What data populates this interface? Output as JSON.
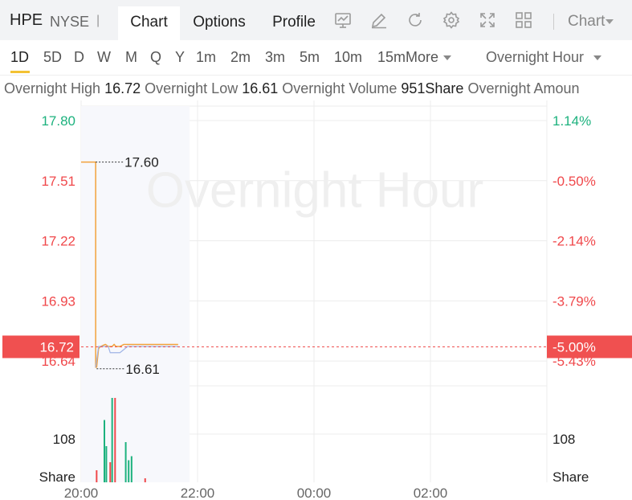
{
  "header": {
    "ticker": "HPE",
    "exchange": "NYSE",
    "separator": "|",
    "tabs": [
      {
        "label": "Chart",
        "active": true
      },
      {
        "label": "Options",
        "active": false
      },
      {
        "label": "Profile",
        "active": false
      }
    ],
    "toolbar_icons": [
      "indicator-chart-icon",
      "draw-pen-icon",
      "refresh-icon",
      "settings-gear-icon",
      "fullscreen-icon",
      "layout-grid-icon"
    ],
    "chart_type_label": "Chart"
  },
  "periods": {
    "items": [
      "1D",
      "5D",
      "D",
      "W",
      "M",
      "Q",
      "Y",
      "1m",
      "2m",
      "3m",
      "5m",
      "10m",
      "15m"
    ],
    "selected": "1D",
    "more_label": "More",
    "session_label": "Overnight Hour"
  },
  "stats": {
    "high_label": "Overnight High",
    "high_value": "16.72",
    "low_label": "Overnight Low",
    "low_value": "16.61",
    "volume_label": "Overnight Volume",
    "volume_value": "951Share",
    "amount_label": "Overnight Amoun"
  },
  "colors": {
    "up": "#1db27e",
    "down": "#f0484b",
    "price_line": "#f2a13a",
    "avg_line": "#9fb4e6",
    "current_tag": "#f05050",
    "grid": "#ececec",
    "watermark": "#efefef"
  },
  "chart_data": {
    "type": "line",
    "watermark": "Overnight Hour",
    "y_left_ticks": [
      "17.80",
      "17.51",
      "17.22",
      "16.93",
      "16.64"
    ],
    "y_right_ticks": [
      "1.14%",
      "-0.50%",
      "-2.14%",
      "-3.79%",
      "-5.43%"
    ],
    "y_tick_values": [
      17.8,
      17.51,
      17.22,
      16.93,
      16.64
    ],
    "x_ticks": [
      "20:00",
      "22:00",
      "00:00",
      "02:00"
    ],
    "current_price": "16.72",
    "current_change": "-5.00%",
    "high_marker": "17.60",
    "low_marker": "16.61",
    "price_series": {
      "name": "",
      "x_minutes": [
        0,
        15,
        15,
        16,
        18,
        20,
        25,
        28,
        32,
        34,
        36,
        40,
        44,
        48,
        55,
        62,
        70,
        85,
        100
      ],
      "values": [
        17.6,
        17.6,
        16.61,
        16.61,
        16.7,
        16.71,
        16.72,
        16.71,
        16.71,
        16.72,
        16.71,
        16.71,
        16.72,
        16.72,
        16.72,
        16.72,
        16.72,
        16.72,
        16.72
      ]
    },
    "avg_series": {
      "name": "",
      "x_minutes": [
        15,
        18,
        22,
        28,
        30,
        35,
        40,
        48,
        55,
        62,
        70,
        85,
        100
      ],
      "values": [
        16.61,
        16.71,
        16.71,
        16.71,
        16.68,
        16.68,
        16.68,
        16.71,
        16.71,
        16.71,
        16.71,
        16.71,
        16.71
      ]
    },
    "x_range_minutes": [
      0,
      480
    ],
    "y_range": [
      16.52,
      17.87
    ],
    "volume": {
      "tick_label": "108",
      "unit_label": "Share",
      "tick_value": 108,
      "range": [
        0,
        240
      ],
      "bars": [
        {
          "t": 16,
          "v": 30,
          "dir": "down"
        },
        {
          "t": 24,
          "v": 155,
          "dir": "up"
        },
        {
          "t": 26,
          "v": 90,
          "dir": "up"
        },
        {
          "t": 30,
          "v": 50,
          "dir": "down"
        },
        {
          "t": 32,
          "v": 210,
          "dir": "up"
        },
        {
          "t": 35,
          "v": 210,
          "dir": "down"
        },
        {
          "t": 46,
          "v": 100,
          "dir": "up"
        },
        {
          "t": 49,
          "v": 55,
          "dir": "up"
        },
        {
          "t": 52,
          "v": 65,
          "dir": "up"
        },
        {
          "t": 66,
          "v": 10,
          "dir": "down"
        }
      ]
    }
  }
}
